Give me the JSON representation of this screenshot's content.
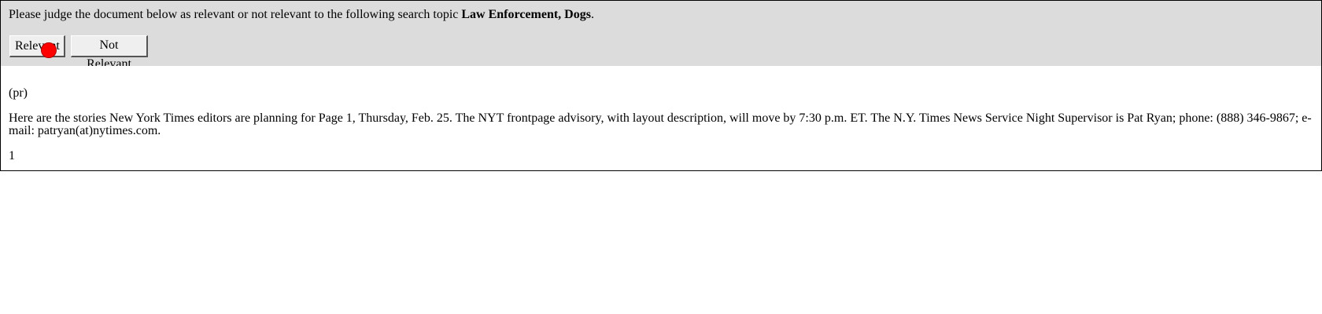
{
  "judge": {
    "prompt_prefix": "Please judge the document below as relevant or not relevant to the following search topic ",
    "topic": "Law Enforcement, Dogs",
    "prompt_suffix": ".",
    "relevant_label": "Relevant",
    "not_relevant_label": "Not Relevant"
  },
  "document": {
    "tag": "(pr)",
    "body": "Here are the stories New York Times editors are planning for Page 1, Thursday, Feb. 25. The NYT frontpage advisory, with layout description, will move by 7:30 p.m. ET. The N.Y. Times News Service Night Supervisor is Pat Ryan; phone: (888) 346-9867; e-mail: patryan(at)nytimes.com.",
    "page_number": "1"
  },
  "colors": {
    "panel_background": "#dcdcdc",
    "cursor_marker": "#ff0000"
  }
}
